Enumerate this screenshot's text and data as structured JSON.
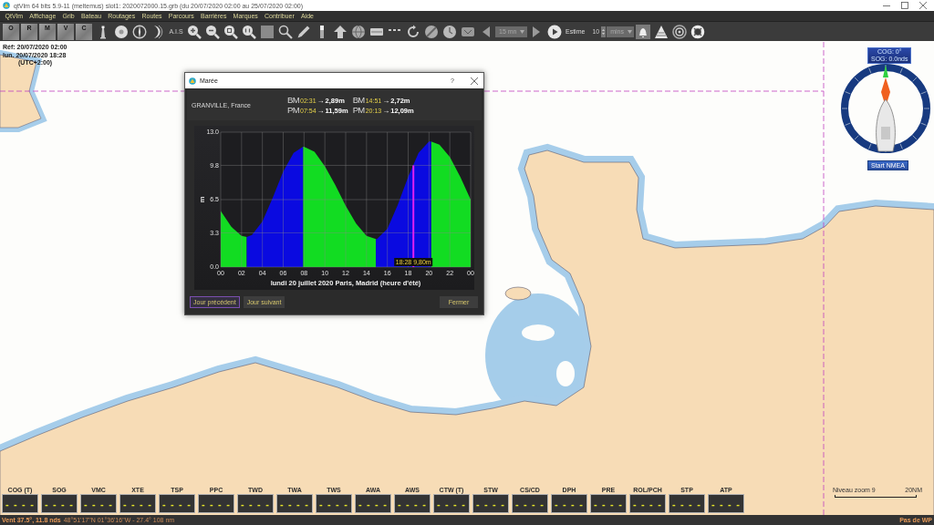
{
  "window": {
    "title": "qtVlm 64 bits 5.9-11 (meltemus) slot1: 2020072000.15.grb (du 20/07/2020 02:00 au 25/07/2020 02:00)"
  },
  "menu": [
    "QtVlm",
    "Affichage",
    "Grib",
    "Bateau",
    "Routages",
    "Routes",
    "Parcours",
    "Barrières",
    "Marques",
    "Contribuer",
    "Aide"
  ],
  "toolbar": {
    "layers": [
      "O",
      "R",
      "M",
      "V",
      "C"
    ],
    "ais": "A.I.S",
    "step": "15 mn",
    "estime_label": "Estime",
    "estime_value": "10",
    "estime_unit": "mins"
  },
  "map_info": [
    "Réf: 20/07/2020 02:00",
    "lun. 20/07/2020 18:28",
    "(UTC+2:00)"
  ],
  "compass": {
    "cog": "COG: 0°",
    "sog": "SOG: 0.0nds",
    "button": "Start NMEA"
  },
  "tide_dialog": {
    "title": "Marée",
    "help": "?",
    "location": "GRANVILLE, France",
    "tides": [
      {
        "type": "BM",
        "time": "02:31",
        "arrow": "→",
        "height": "2,89m"
      },
      {
        "type": "BM",
        "time": "14:51",
        "arrow": "→",
        "height": "2,72m"
      },
      {
        "type": "PM",
        "time": "07:54",
        "arrow": "→",
        "height": "11,59m"
      },
      {
        "type": "PM",
        "time": "20:13",
        "arrow": "→",
        "height": "12,09m"
      }
    ],
    "chart_data": {
      "type": "area",
      "xlabel": "lundi 20 juillet 2020 Paris, Madrid (heure d'été)",
      "ylabel": "m",
      "grid": true,
      "x": [
        0,
        1,
        2,
        2.5,
        3,
        4,
        5,
        6,
        7,
        7.9,
        8,
        9,
        10,
        11,
        12,
        13,
        14,
        14.9,
        15,
        16,
        17,
        18,
        19,
        20,
        20.2,
        21,
        22,
        23,
        24
      ],
      "series": [
        {
          "color": "#12dc22",
          "values": [
            5.4,
            3.9,
            3.0,
            2.9,
            null,
            null,
            null,
            null,
            null,
            11.6,
            11.6,
            11.1,
            9.7,
            7.9,
            5.9,
            4.2,
            3.0,
            2.7,
            null,
            null,
            null,
            null,
            null,
            null,
            12.1,
            11.8,
            10.6,
            8.7,
            6.5
          ]
        },
        {
          "color": "#0a0ae0",
          "values": [
            null,
            null,
            null,
            2.9,
            3.1,
            4.4,
            6.7,
            9.2,
            11.0,
            11.6,
            null,
            null,
            null,
            null,
            null,
            null,
            null,
            2.7,
            2.7,
            3.7,
            6.0,
            8.7,
            11.0,
            12.1,
            12.1,
            null,
            null,
            null,
            null
          ]
        }
      ],
      "xlim": [
        0,
        24
      ],
      "ylim": [
        0,
        13
      ],
      "xticks": [
        {
          "value": 0,
          "label": "00"
        },
        {
          "value": 2,
          "label": "02"
        },
        {
          "value": 4,
          "label": "04"
        },
        {
          "value": 6,
          "label": "06"
        },
        {
          "value": 8,
          "label": "08"
        },
        {
          "value": 10,
          "label": "10"
        },
        {
          "value": 12,
          "label": "12"
        },
        {
          "value": 14,
          "label": "14"
        },
        {
          "value": 16,
          "label": "16"
        },
        {
          "value": 18,
          "label": "18"
        },
        {
          "value": 20,
          "label": "20"
        },
        {
          "value": 22,
          "label": "22"
        },
        {
          "value": 24,
          "label": "00"
        }
      ],
      "yticks": [
        {
          "value": 0,
          "label": "0.0"
        },
        {
          "value": 3.3,
          "label": "3.3"
        },
        {
          "value": 6.5,
          "label": "6.5"
        },
        {
          "value": 9.8,
          "label": "9.8"
        },
        {
          "value": 13,
          "label": "13.0"
        }
      ],
      "annotations": [
        {
          "x": 18.5,
          "y": 9.8,
          "text": "18:28 9,80m"
        }
      ]
    },
    "buttons": [
      {
        "label": "Jour précédent",
        "focused": true
      },
      {
        "label": "Jour suivant",
        "focused": false
      },
      {
        "label": "Fermer",
        "focused": false
      }
    ]
  },
  "instruments": [
    {
      "label": "COG (T)",
      "value": "- - - -"
    },
    {
      "label": "SOG",
      "value": "- - - -"
    },
    {
      "label": "VMC",
      "value": "- - - -"
    },
    {
      "label": "XTE",
      "value": "- - - -"
    },
    {
      "label": "TSP",
      "value": "- - - -"
    },
    {
      "label": "PPC",
      "value": "- - - -"
    },
    {
      "label": "TWD",
      "value": "- - - -"
    },
    {
      "label": "TWA",
      "value": "- - - -"
    },
    {
      "label": "TWS",
      "value": "- - - -"
    },
    {
      "label": "AWA",
      "value": "- - - -"
    },
    {
      "label": "AWS",
      "value": "- - - -"
    },
    {
      "label": "CTW (T)",
      "value": "- - - -"
    },
    {
      "label": "STW",
      "value": "- - - -"
    },
    {
      "label": "CS/CD",
      "value": "- - - -"
    },
    {
      "label": "DPH",
      "value": "- - - -"
    },
    {
      "label": "PRE",
      "value": "- - - -"
    },
    {
      "label": "ROL/PCH",
      "value": "- - - -"
    },
    {
      "label": "STP",
      "value": "- - - -"
    },
    {
      "label": "ATP",
      "value": "- - - -"
    }
  ],
  "scale": {
    "label": "Niveau zoom 9",
    "distance": "20NM"
  },
  "status_bar": {
    "wind": "Vent 37.5°, 11.8 nds",
    "position": "48°51'17\"N 01°36'16\"W - 27.4° 108 nm",
    "waypoint": "Pas de WP"
  }
}
